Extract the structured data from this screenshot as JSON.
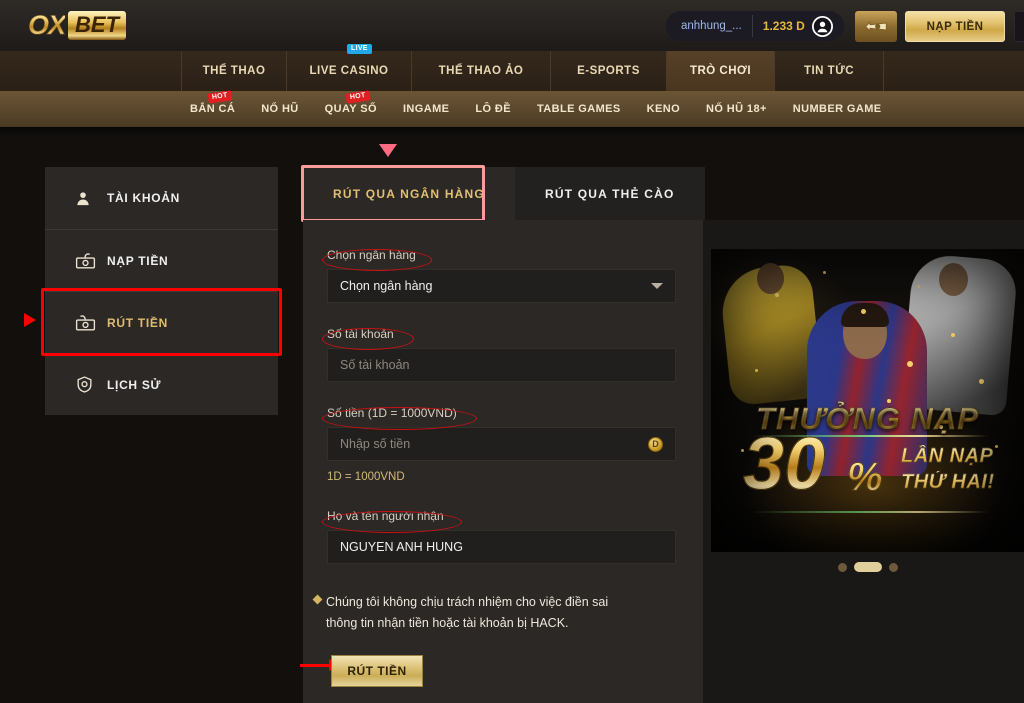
{
  "brand": {
    "logo_ox": "OX",
    "logo_bet": "BET"
  },
  "topbar": {
    "account_name": "anhhung_...",
    "balance": "1.233 D",
    "deposit_button": "NẠP TIỀN"
  },
  "mainnav": [
    {
      "label": "THỂ THAO",
      "badge": null,
      "active": false
    },
    {
      "label": "LIVE CASINO",
      "badge": "LIVE",
      "active": false
    },
    {
      "label": "THỂ THAO ẢO",
      "badge": null,
      "active": false
    },
    {
      "label": "E-SPORTS",
      "badge": null,
      "active": false
    },
    {
      "label": "TRÒ CHƠI",
      "badge": null,
      "active": true
    },
    {
      "label": "TIN TỨC",
      "badge": null,
      "active": false
    }
  ],
  "subnav": [
    {
      "label": "BẮN CÁ",
      "badge": "HOT"
    },
    {
      "label": "NỔ HŨ",
      "badge": null
    },
    {
      "label": "QUAY SỐ",
      "badge": "HOT"
    },
    {
      "label": "INGAME",
      "badge": null
    },
    {
      "label": "LÔ ĐỀ",
      "badge": null
    },
    {
      "label": "TABLE GAMES",
      "badge": null
    },
    {
      "label": "KENO",
      "badge": null
    },
    {
      "label": "NỔ HŨ 18+",
      "badge": null
    },
    {
      "label": "NUMBER GAME",
      "badge": null
    }
  ],
  "sidebar": [
    {
      "label": "TÀI KHOẢN",
      "icon": "user-icon",
      "selected": false
    },
    {
      "label": "NẠP TIỀN",
      "icon": "money-deposit-icon",
      "selected": false
    },
    {
      "label": "RÚT TIỀN",
      "icon": "money-withdraw-icon",
      "selected": true
    },
    {
      "label": "LỊCH SỬ",
      "icon": "history-shield-icon",
      "selected": false
    }
  ],
  "tabs": [
    {
      "label": "RÚT QUA NGÂN HÀNG",
      "active": true
    },
    {
      "label": "RÚT QUA THẺ CÀO",
      "active": false
    }
  ],
  "form": {
    "bank_label": "Chọn ngân hàng",
    "bank_value": "Chọn ngân hàng",
    "account_label": "Số tài khoản",
    "account_placeholder": "Số tài khoản",
    "amount_label": "Số tiền (1D = 1000VND)",
    "amount_placeholder": "Nhập số tiền",
    "amount_coin": "D",
    "rate_hint": "1D = 1000VND",
    "name_label": "Họ và tên người nhận",
    "name_value": "NGUYEN ANH HUNG",
    "note_line1": "Chúng tôi không chịu trách nhiệm cho việc điền sai",
    "note_line2": "thông tin nhận tiền hoặc tài khoản bị HACK.",
    "submit_label": "RÚT TIỀN"
  },
  "banner": {
    "title": "THƯỞNG NẠP",
    "percent_number": "30",
    "percent_symbol": "%",
    "right_line1": "LẦN NẠP",
    "right_line2": "THỨ HAI!"
  },
  "colors": {
    "gold": "#e2bf71",
    "annotation_red": "#ff0000",
    "tab_highlight": "#ff9a9a",
    "panel_bg": "#2b2826",
    "page_bg": "#120f0d"
  }
}
